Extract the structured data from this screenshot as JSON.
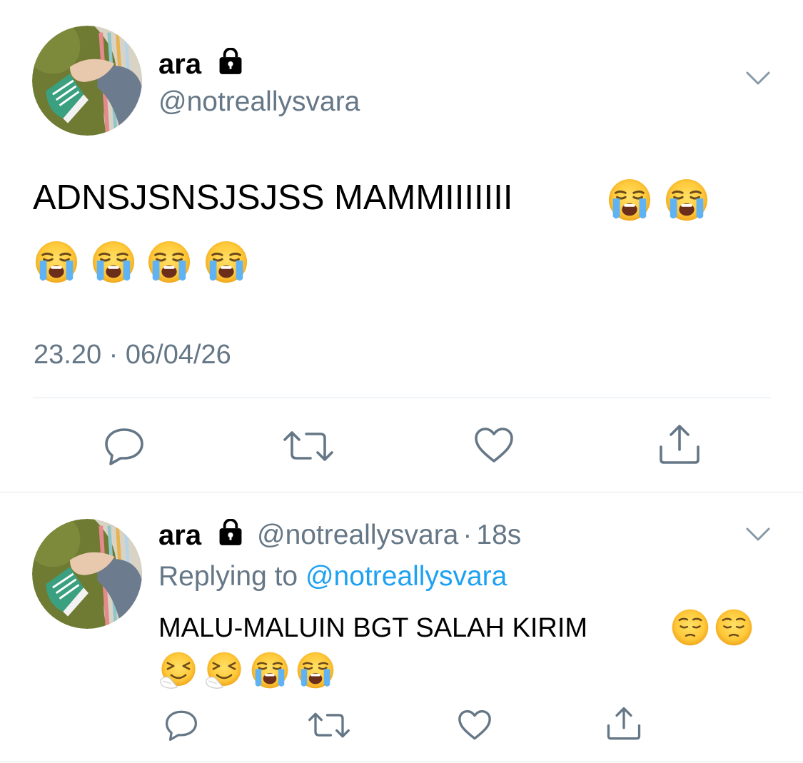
{
  "main_tweet": {
    "author_name": "ara",
    "handle": "@notreallysvara",
    "text": "ADNSJSNSJSJSS MAMMIIIIIII",
    "emoji_line1": [
      "loudly-crying-face",
      "loudly-crying-face"
    ],
    "emoji_line2": [
      "loudly-crying-face",
      "loudly-crying-face",
      "loudly-crying-face",
      "loudly-crying-face"
    ],
    "time": "23.20",
    "separator": "·",
    "date": "06/04/26"
  },
  "reply_tweet": {
    "author_name": "ara",
    "handle": "@notreallysvara",
    "age_separator": "·",
    "age": "18s",
    "replying_prefix": "Replying to",
    "replying_handle": "@notreallysvara",
    "text": "MALU-MALUIN BGT SALAH KIRIM",
    "emoji_line1": [
      "pensive-face",
      "pensive-face"
    ],
    "emoji_line2": [
      "sneezing-face",
      "sneezing-face",
      "loudly-crying-face",
      "loudly-crying-face"
    ]
  },
  "colors": {
    "secondary_text": "#657786",
    "link": "#1da1f2",
    "divider": "#e1e8ed",
    "icon": "#657786"
  },
  "actions": [
    "reply-icon",
    "retweet-icon",
    "like-icon",
    "share-icon"
  ]
}
